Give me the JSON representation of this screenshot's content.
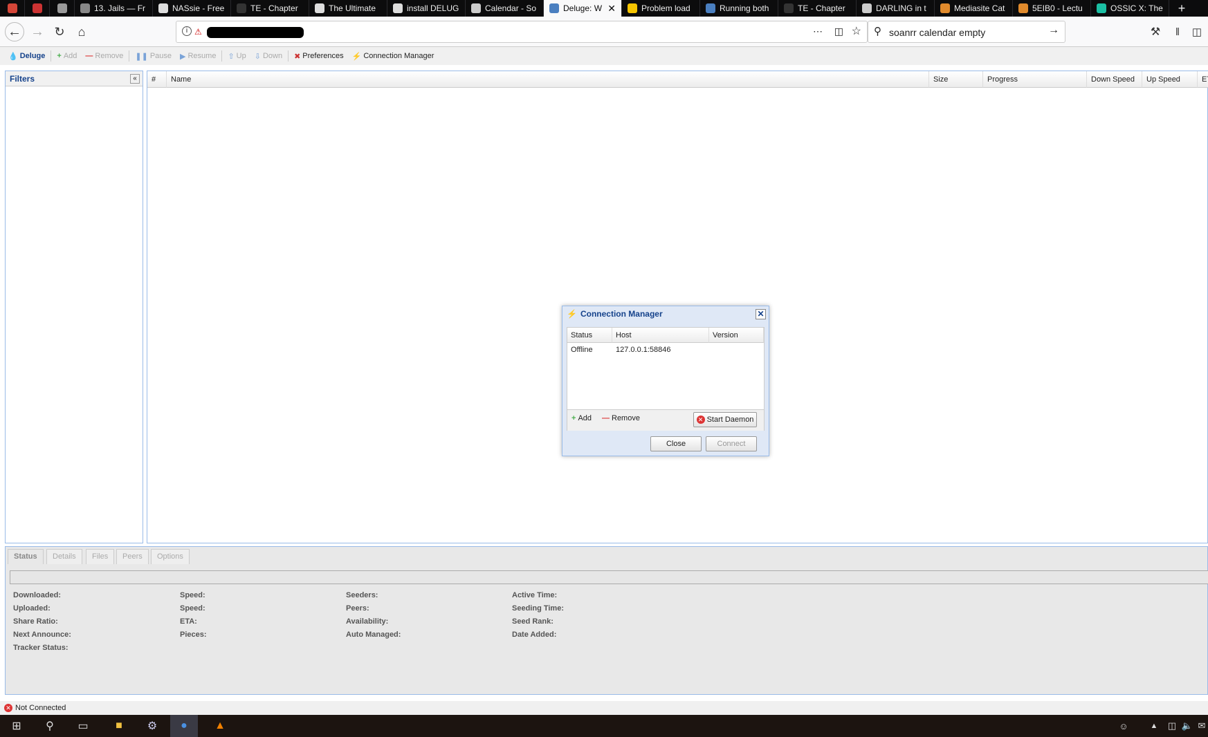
{
  "browser": {
    "tabs": [
      {
        "label": "",
        "icon": "gmail-icon",
        "color": "#d44638",
        "pinned": true
      },
      {
        "label": "",
        "icon": "calendar-pinned-icon",
        "color": "#c33",
        "pinned": true
      },
      {
        "label": "",
        "icon": "github-icon",
        "color": "#999",
        "pinned": true
      },
      {
        "label": "13. Jails — Fr",
        "icon": "freebsd-icon",
        "color": "#888"
      },
      {
        "label": "NASsie - Free",
        "icon": "page-icon",
        "color": "#ddd"
      },
      {
        "label": "TE - Chapter",
        "icon": "page-icon",
        "color": "#333"
      },
      {
        "label": "The Ultimate",
        "icon": "page-icon",
        "color": "#ddd"
      },
      {
        "label": "install DELUG",
        "icon": "page-icon",
        "color": "#ddd"
      },
      {
        "label": "Calendar - So",
        "icon": "sonarr-icon",
        "color": "#ccc"
      },
      {
        "label": "Deluge: W",
        "icon": "deluge-icon",
        "color": "#4a7fc0",
        "active": true
      },
      {
        "label": "Problem load",
        "icon": "warning-icon",
        "color": "#f5c400"
      },
      {
        "label": "Running both",
        "icon": "deluge-icon",
        "color": "#4a7fc0"
      },
      {
        "label": "TE - Chapter",
        "icon": "page-icon",
        "color": "#333"
      },
      {
        "label": "DARLING in t",
        "icon": "sonarr-icon",
        "color": "#ccc"
      },
      {
        "label": "Mediasite Cat",
        "icon": "mediasite-icon",
        "color": "#e08a2c"
      },
      {
        "label": "5EIB0 - Lectu",
        "icon": "mediasite-icon",
        "color": "#e08a2c"
      },
      {
        "label": "OSSIC X: The",
        "icon": "kickstarter-icon",
        "color": "#1bbfa3"
      }
    ],
    "search_query": "soanrr calendar empty"
  },
  "toolbar": {
    "brand": "Deluge",
    "add": "Add",
    "remove": "Remove",
    "pause": "Pause",
    "resume": "Resume",
    "up": "Up",
    "down": "Down",
    "preferences": "Preferences",
    "connection_manager": "Connection Manager"
  },
  "filters": {
    "title": "Filters"
  },
  "grid": {
    "columns": [
      "#",
      "Name",
      "Size",
      "Progress",
      "Down Speed",
      "Up Speed",
      "ETA"
    ]
  },
  "details": {
    "tabs": [
      "Status",
      "Details",
      "Files",
      "Peers",
      "Options"
    ],
    "labels": [
      [
        "Downloaded:",
        "Uploaded:",
        "Share Ratio:",
        "Next Announce:",
        "Tracker Status:"
      ],
      [
        "Speed:",
        "Speed:",
        "ETA:",
        "Pieces:"
      ],
      [
        "Seeders:",
        "Peers:",
        "Availability:",
        "Auto Managed:"
      ],
      [
        "Active Time:",
        "Seeding Time:",
        "Seed Rank:",
        "Date Added:"
      ]
    ]
  },
  "status_bar": {
    "text": "Not Connected"
  },
  "dialog": {
    "title": "Connection Manager",
    "columns": [
      "Status",
      "Host",
      "Version"
    ],
    "rows": [
      {
        "status": "Offline",
        "host": "127.0.0.1:58846",
        "version": ""
      }
    ],
    "add": "Add",
    "remove": "Remove",
    "start_daemon": "Start Daemon",
    "close": "Close",
    "connect": "Connect"
  }
}
